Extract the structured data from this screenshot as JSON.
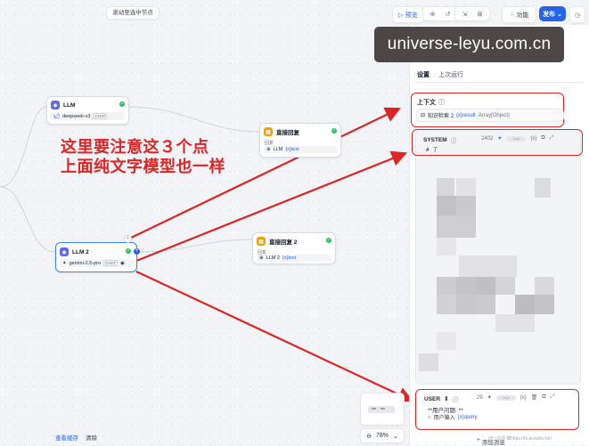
{
  "canvas": {
    "scroll_to_selected": "滚动至选中节点",
    "bottom": {
      "view_cache": "查看缓存",
      "clear": "清除"
    },
    "zoom": "78%"
  },
  "toolbar": {
    "preview": "预览",
    "features": "功能",
    "publish": "发布",
    "icons": [
      "debug-icon",
      "history-icon",
      "import-icon",
      "export-icon",
      "settings-icon",
      "clock-icon"
    ]
  },
  "nodes": {
    "llm1": {
      "title": "LLM",
      "model": "deepseek-v3",
      "model_tag": "CHAT"
    },
    "answer1": {
      "title": "直接回复",
      "label": "回复",
      "source": "LLM",
      "var": "{x}text"
    },
    "llm2": {
      "title": "LLM 2",
      "model": "gemini-2.5-pro",
      "model_tag": "CHAT"
    },
    "answer2": {
      "title": "直接回复 2",
      "label": "回复",
      "source": "LLM 2",
      "var": "{x}text"
    }
  },
  "annotation": {
    "line1": "这里要注意这３个点",
    "line2": "上面纯文字模型也一样",
    "color": "#e02424"
  },
  "watermark": "universe-leyu.com.cn",
  "panel": {
    "tabs": [
      "设置",
      "上次运行"
    ],
    "context": {
      "label": "上下文",
      "source": "知识检索 2",
      "var": "{x}result",
      "type": "Array[Object]"
    },
    "system": {
      "label": "SYSTEM",
      "count": "2402",
      "jinja": "Jinja",
      "first_line": "# 了"
    },
    "user": {
      "label": "USER",
      "count": "29",
      "jinja": "Jinja",
      "line1": "**用户问题: **",
      "source": "用户输入",
      "var": "{x}query"
    },
    "add_message": "添加消息"
  },
  "footer_mark": "@一只牛博https://hi.acowbo.fun"
}
